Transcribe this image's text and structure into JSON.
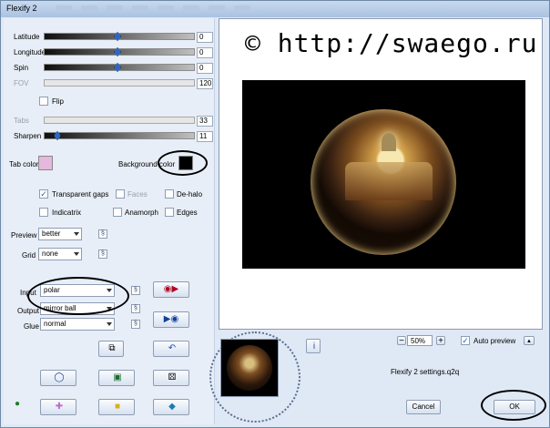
{
  "window": {
    "title": "Flexify 2"
  },
  "sliders": [
    {
      "label": "Latitude",
      "value": "0",
      "enabled": true
    },
    {
      "label": "Longitude",
      "value": "0",
      "enabled": true
    },
    {
      "label": "Spin",
      "value": "0",
      "enabled": true
    },
    {
      "label": "FOV",
      "value": "120",
      "enabled": false
    },
    {
      "label": "Tabs",
      "value": "33",
      "enabled": false
    },
    {
      "label": "Sharpen",
      "value": "11",
      "enabled": true
    }
  ],
  "checks": {
    "flip": "Flip",
    "transparent_gaps": "Transparent gaps",
    "faces": "Faces",
    "de_halo": "De-halo",
    "indicatrix": "Indicatrix",
    "anamorph": "Anamorph",
    "edges": "Edges",
    "auto_preview": "Auto preview"
  },
  "colors": {
    "tab_color_label": "Tab color",
    "background_color_label": "Background color",
    "tab_color": "#e5b8dd",
    "background_color": "#000000"
  },
  "dropdowns": {
    "preview_label": "Preview",
    "preview_value": "better",
    "grid_label": "Grid",
    "grid_value": "none",
    "input_label": "Input",
    "input_value": "polar",
    "output_label": "Output",
    "output_value": "mirror ball",
    "glue_label": "Glue",
    "glue_value": "normal"
  },
  "watermark": "© http://swaego.ru",
  "zoom": "50%",
  "settings_file": "Flexify 2 settings.q2q",
  "buttons": {
    "cancel": "Cancel",
    "ok": "OK"
  },
  "icons": {
    "info": "i",
    "minus": "−",
    "plus": "+",
    "up": "▲"
  }
}
